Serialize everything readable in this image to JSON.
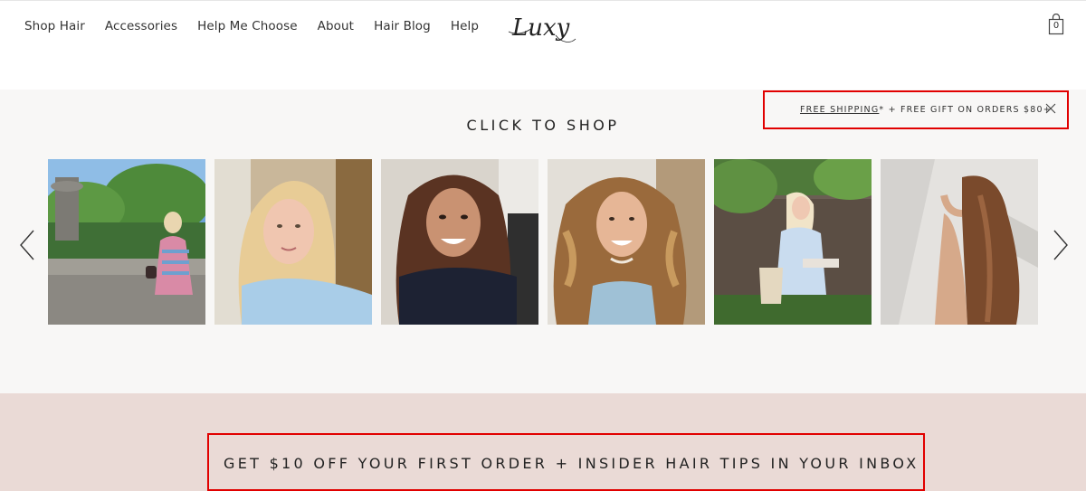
{
  "nav": {
    "items": [
      "Shop Hair",
      "Accessories",
      "Help Me Choose",
      "About",
      "Hair Blog",
      "Help"
    ]
  },
  "logo": {
    "text": "Luxy"
  },
  "cart": {
    "count": "0"
  },
  "promo": {
    "link_text": "FREE SHIPPING",
    "rest_text": "* + FREE GIFT ON ORDERS $80+"
  },
  "shop": {
    "title": "CLICK TO SHOP"
  },
  "newsletter": {
    "headline": "GET $10 OFF YOUR FIRST ORDER + INSIDER HAIR TIPS IN YOUR INBOX"
  },
  "colors": {
    "highlight": "#e10000",
    "section_bg": "#f8f7f6",
    "newsletter_bg": "#eadad6"
  }
}
